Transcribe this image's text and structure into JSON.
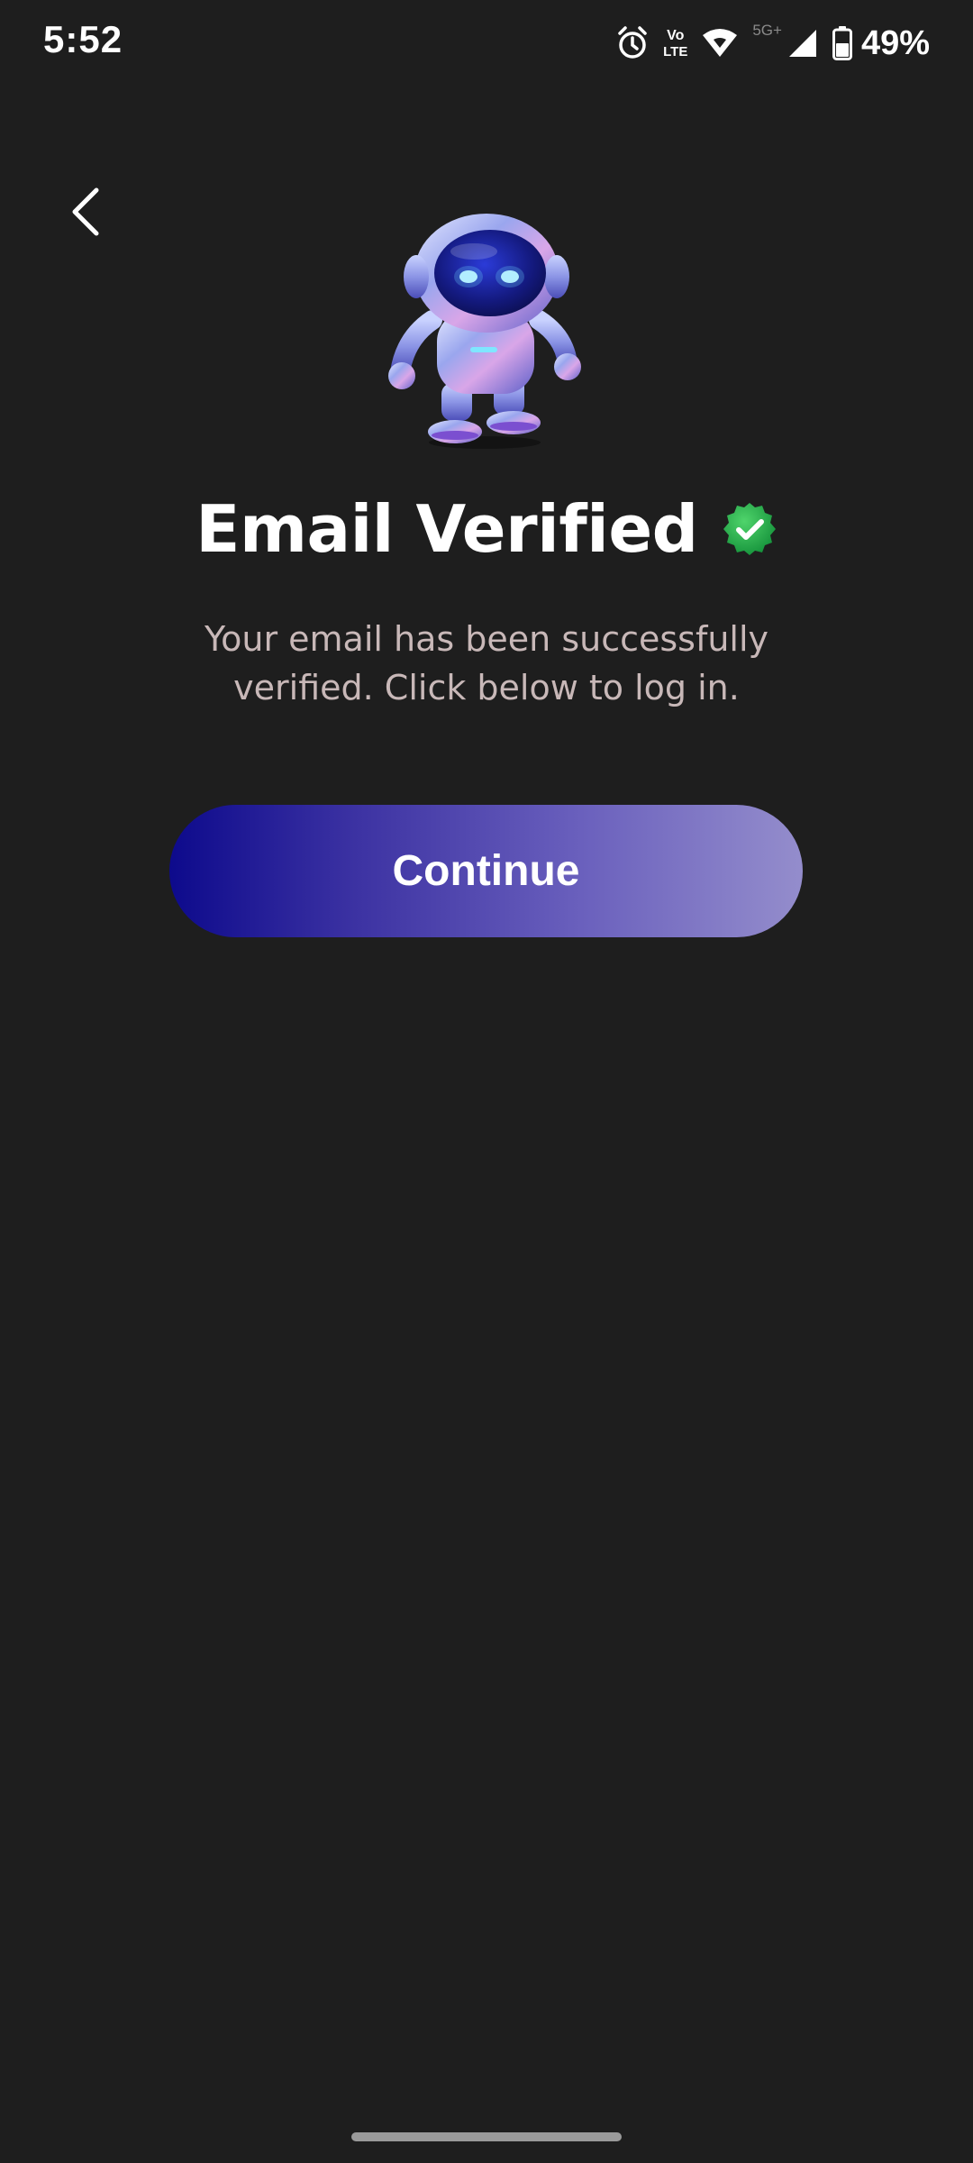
{
  "status_bar": {
    "time": "5:52",
    "network_vo": "Vo",
    "network_lte": "LTE",
    "network_type": "5G+",
    "battery_percent": "49%",
    "icons": [
      "alarm-icon",
      "volte-icon",
      "wifi-icon",
      "signal-icon",
      "battery-icon"
    ]
  },
  "header": {
    "back_icon": "chevron-left-icon"
  },
  "hero": {
    "illustration": "robot-astronaut"
  },
  "content": {
    "title": "Email Verified",
    "badge_icon": "verified-check-icon",
    "subtitle": "Your email has been successfully verified. Click below to log in."
  },
  "actions": {
    "continue_label": "Continue"
  },
  "colors": {
    "background": "#1e1e1e",
    "button_gradient_start": "#0d0a8c",
    "button_gradient_end": "#948dcc",
    "badge_green": "#22b04b",
    "subtitle_text": "#c8b8b8"
  }
}
